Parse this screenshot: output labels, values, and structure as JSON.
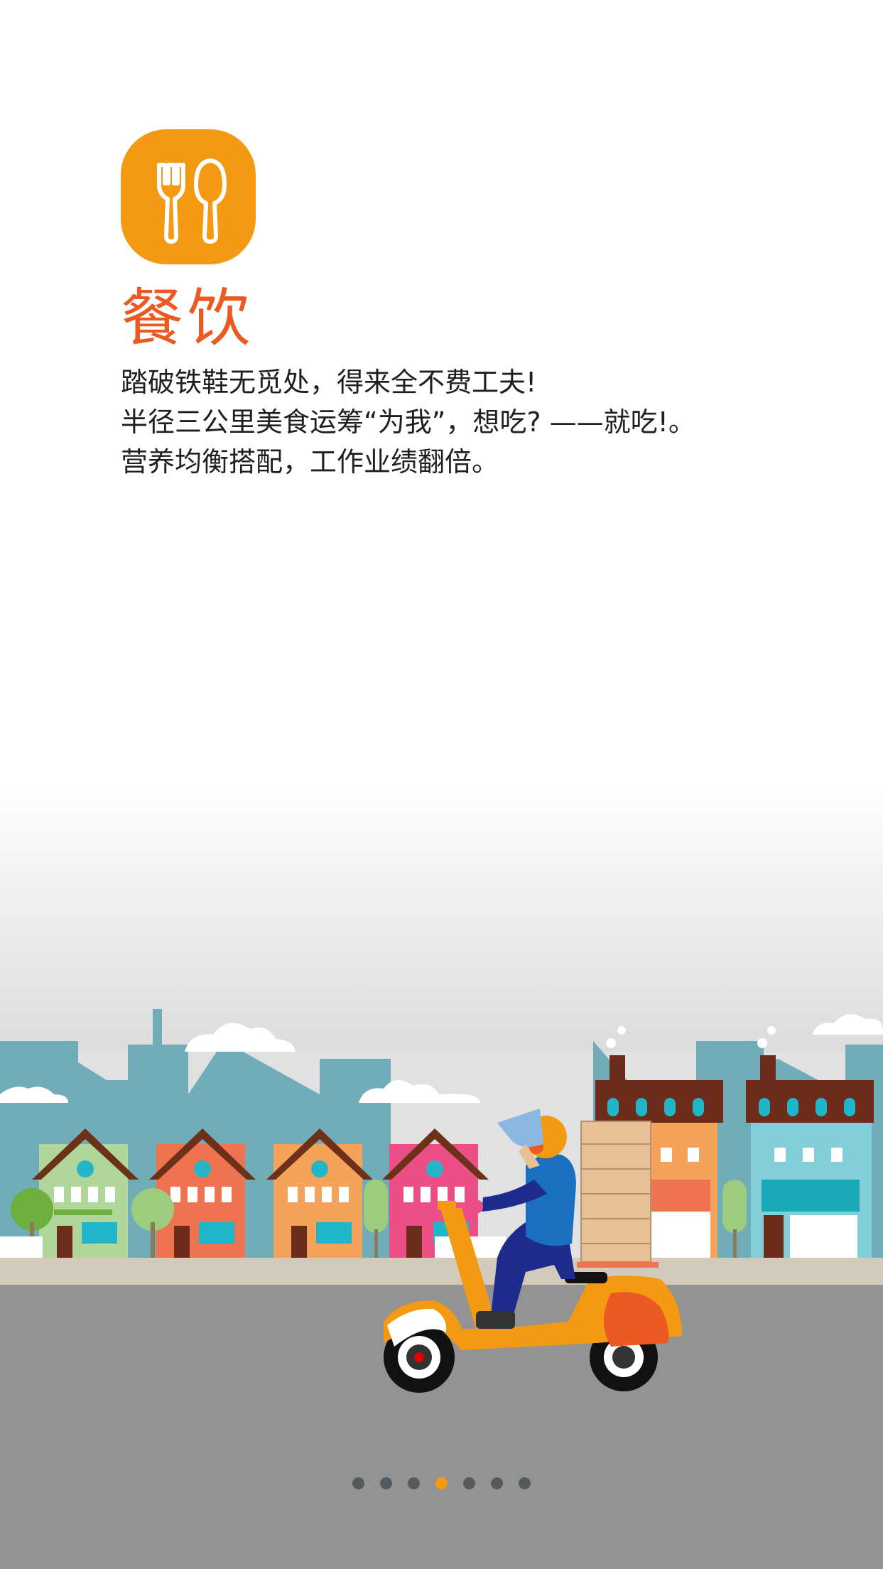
{
  "category": {
    "icon": "fork-spoon-icon",
    "title": "餐饮"
  },
  "description": {
    "lines": [
      "踏破铁鞋无觅处，得来全不费工夫!",
      "半径三公里美食运筹“为我”，想吃? ——就吃!。",
      "营养均衡搭配，工作业绩翻倍。"
    ]
  },
  "illustration": {
    "subject": "delivery-scooter-street-scene"
  },
  "pager": {
    "total": 7,
    "active_index": 3
  },
  "colors": {
    "accent": "#f39a12",
    "title": "#ea5a22",
    "road": "#939393",
    "text": "#1f1f1f"
  }
}
